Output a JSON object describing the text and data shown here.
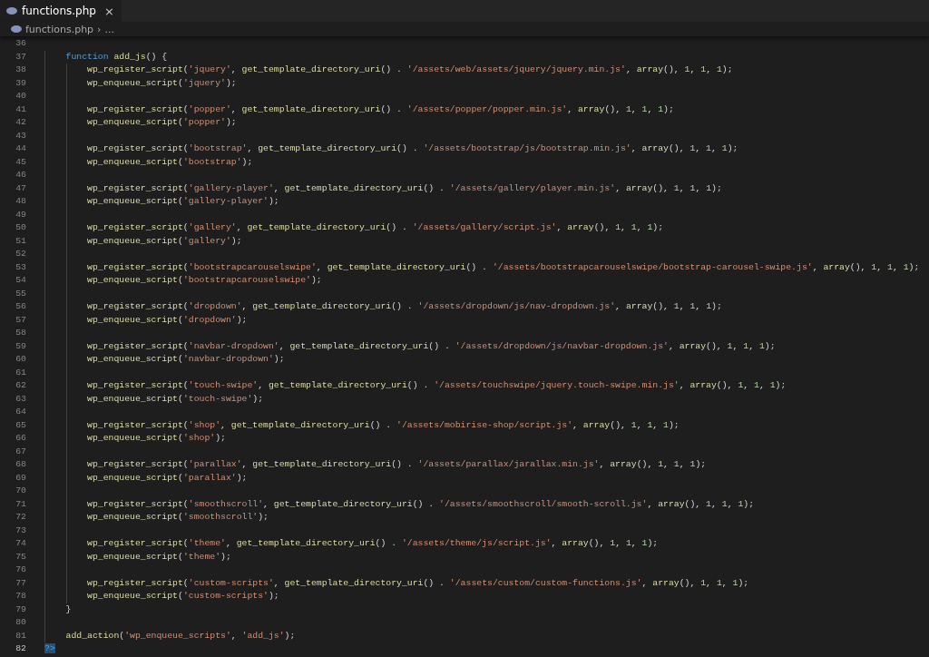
{
  "tabs": [
    {
      "label": "functions.php",
      "close": "×",
      "selected": true
    }
  ],
  "breadcrumb": {
    "file": "functions.php",
    "separator": "›",
    "more": "..."
  },
  "editor": {
    "lines": [
      {
        "number": "36",
        "current": false
      },
      {
        "number": "37",
        "current": false,
        "tokens": [
          {
            "kind": "kw",
            "text": "    function "
          },
          {
            "kind": "fn",
            "text": "add_js"
          },
          {
            "kind": "p",
            "text": "() {"
          }
        ]
      },
      {
        "number": "38",
        "current": false,
        "tokens": [
          {
            "kind": "fn",
            "text": "        wp_register_script"
          },
          {
            "kind": "p",
            "text": "("
          },
          {
            "kind": "s",
            "text": "'jquery'"
          },
          {
            "kind": "p",
            "text": ", "
          },
          {
            "kind": "fn",
            "text": "get_template_directory_uri"
          },
          {
            "kind": "p",
            "text": "() . "
          },
          {
            "kind": "s",
            "text": "'/assets/web/assets/jquery/jquery.min.js'"
          },
          {
            "kind": "p",
            "text": ", "
          },
          {
            "kind": "fn",
            "text": "array"
          },
          {
            "kind": "p",
            "text": "(), "
          },
          {
            "kind": "n",
            "text": "1"
          },
          {
            "kind": "p",
            "text": ", "
          },
          {
            "kind": "n",
            "text": "1"
          },
          {
            "kind": "p",
            "text": ", "
          },
          {
            "kind": "n",
            "text": "1"
          },
          {
            "kind": "p",
            "text": ");"
          }
        ]
      },
      {
        "number": "39",
        "current": false,
        "tokens": [
          {
            "kind": "fn",
            "text": "        wp_enqueue_script"
          },
          {
            "kind": "p",
            "text": "("
          },
          {
            "kind": "s",
            "text": "'jquery'"
          },
          {
            "kind": "p",
            "text": ");"
          }
        ]
      },
      {
        "number": "40",
        "current": false
      },
      {
        "number": "41",
        "current": false,
        "tokens": [
          {
            "kind": "fn",
            "text": "        wp_register_script"
          },
          {
            "kind": "p",
            "text": "("
          },
          {
            "kind": "s",
            "text": "'popper'"
          },
          {
            "kind": "p",
            "text": ", "
          },
          {
            "kind": "fn",
            "text": "get_template_directory_uri"
          },
          {
            "kind": "p",
            "text": "() . "
          },
          {
            "kind": "s",
            "text": "'/assets/popper/popper.min.js'"
          },
          {
            "kind": "p",
            "text": ", "
          },
          {
            "kind": "fn",
            "text": "array"
          },
          {
            "kind": "p",
            "text": "(), "
          },
          {
            "kind": "n",
            "text": "1"
          },
          {
            "kind": "p",
            "text": ", "
          },
          {
            "kind": "n",
            "text": "1"
          },
          {
            "kind": "p",
            "text": ", "
          },
          {
            "kind": "n",
            "text": "1"
          },
          {
            "kind": "p",
            "text": ");"
          }
        ]
      },
      {
        "number": "42",
        "current": false,
        "tokens": [
          {
            "kind": "fn",
            "text": "        wp_enqueue_script"
          },
          {
            "kind": "p",
            "text": "("
          },
          {
            "kind": "s",
            "text": "'popper'"
          },
          {
            "kind": "p",
            "text": ");"
          }
        ]
      },
      {
        "number": "43",
        "current": false
      },
      {
        "number": "44",
        "current": false,
        "tokens": [
          {
            "kind": "fn",
            "text": "        wp_register_script"
          },
          {
            "kind": "p",
            "text": "("
          },
          {
            "kind": "s",
            "text": "'bootstrap'"
          },
          {
            "kind": "p",
            "text": ", "
          },
          {
            "kind": "fn",
            "text": "get_template_directory_uri"
          },
          {
            "kind": "p",
            "text": "() . "
          },
          {
            "kind": "s",
            "text": "'/assets/bootstrap/js/bootstrap.min.js'"
          },
          {
            "kind": "p",
            "text": ", "
          },
          {
            "kind": "fn",
            "text": "array"
          },
          {
            "kind": "p",
            "text": "(), "
          },
          {
            "kind": "n",
            "text": "1"
          },
          {
            "kind": "p",
            "text": ", "
          },
          {
            "kind": "n",
            "text": "1"
          },
          {
            "kind": "p",
            "text": ", "
          },
          {
            "kind": "n",
            "text": "1"
          },
          {
            "kind": "p",
            "text": ");"
          }
        ]
      },
      {
        "number": "45",
        "current": false,
        "tokens": [
          {
            "kind": "fn",
            "text": "        wp_enqueue_script"
          },
          {
            "kind": "p",
            "text": "("
          },
          {
            "kind": "s",
            "text": "'bootstrap'"
          },
          {
            "kind": "p",
            "text": ");"
          }
        ]
      },
      {
        "number": "46",
        "current": false
      },
      {
        "number": "47",
        "current": false,
        "tokens": [
          {
            "kind": "fn",
            "text": "        wp_register_script"
          },
          {
            "kind": "p",
            "text": "("
          },
          {
            "kind": "s",
            "text": "'gallery-player'"
          },
          {
            "kind": "p",
            "text": ", "
          },
          {
            "kind": "fn",
            "text": "get_template_directory_uri"
          },
          {
            "kind": "p",
            "text": "() . "
          },
          {
            "kind": "s",
            "text": "'/assets/gallery/player.min.js'"
          },
          {
            "kind": "p",
            "text": ", "
          },
          {
            "kind": "fn",
            "text": "array"
          },
          {
            "kind": "p",
            "text": "(), "
          },
          {
            "kind": "n",
            "text": "1"
          },
          {
            "kind": "p",
            "text": ", "
          },
          {
            "kind": "n",
            "text": "1"
          },
          {
            "kind": "p",
            "text": ", "
          },
          {
            "kind": "n",
            "text": "1"
          },
          {
            "kind": "p",
            "text": ");"
          }
        ]
      },
      {
        "number": "48",
        "current": false,
        "tokens": [
          {
            "kind": "fn",
            "text": "        wp_enqueue_script"
          },
          {
            "kind": "p",
            "text": "("
          },
          {
            "kind": "s",
            "text": "'gallery-player'"
          },
          {
            "kind": "p",
            "text": ");"
          }
        ]
      },
      {
        "number": "49",
        "current": false
      },
      {
        "number": "50",
        "current": false,
        "tokens": [
          {
            "kind": "fn",
            "text": "        wp_register_script"
          },
          {
            "kind": "p",
            "text": "("
          },
          {
            "kind": "s",
            "text": "'gallery'"
          },
          {
            "kind": "p",
            "text": ", "
          },
          {
            "kind": "fn",
            "text": "get_template_directory_uri"
          },
          {
            "kind": "p",
            "text": "() . "
          },
          {
            "kind": "s",
            "text": "'/assets/gallery/script.js'"
          },
          {
            "kind": "p",
            "text": ", "
          },
          {
            "kind": "fn",
            "text": "array"
          },
          {
            "kind": "p",
            "text": "(), "
          },
          {
            "kind": "n",
            "text": "1"
          },
          {
            "kind": "p",
            "text": ", "
          },
          {
            "kind": "n",
            "text": "1"
          },
          {
            "kind": "p",
            "text": ", "
          },
          {
            "kind": "n",
            "text": "1"
          },
          {
            "kind": "p",
            "text": ");"
          }
        ]
      },
      {
        "number": "51",
        "current": false,
        "tokens": [
          {
            "kind": "fn",
            "text": "        wp_enqueue_script"
          },
          {
            "kind": "p",
            "text": "("
          },
          {
            "kind": "s",
            "text": "'gallery'"
          },
          {
            "kind": "p",
            "text": ");"
          }
        ]
      },
      {
        "number": "52",
        "current": false
      },
      {
        "number": "53",
        "current": false,
        "tokens": [
          {
            "kind": "fn",
            "text": "        wp_register_script"
          },
          {
            "kind": "p",
            "text": "("
          },
          {
            "kind": "s",
            "text": "'bootstrapcarouselswipe'"
          },
          {
            "kind": "p",
            "text": ", "
          },
          {
            "kind": "fn",
            "text": "get_template_directory_uri"
          },
          {
            "kind": "p",
            "text": "() . "
          },
          {
            "kind": "s",
            "text": "'/assets/bootstrapcarouselswipe/bootstrap-carousel-swipe.js'"
          },
          {
            "kind": "p",
            "text": ", "
          },
          {
            "kind": "fn",
            "text": "array"
          },
          {
            "kind": "p",
            "text": "(), "
          },
          {
            "kind": "n",
            "text": "1"
          },
          {
            "kind": "p",
            "text": ", "
          },
          {
            "kind": "n",
            "text": "1"
          },
          {
            "kind": "p",
            "text": ", "
          },
          {
            "kind": "n",
            "text": "1"
          },
          {
            "kind": "p",
            "text": ");"
          }
        ]
      },
      {
        "number": "54",
        "current": false,
        "tokens": [
          {
            "kind": "fn",
            "text": "        wp_enqueue_script"
          },
          {
            "kind": "p",
            "text": "("
          },
          {
            "kind": "s",
            "text": "'bootstrapcarouselswipe'"
          },
          {
            "kind": "p",
            "text": ");"
          }
        ]
      },
      {
        "number": "55",
        "current": false
      },
      {
        "number": "56",
        "current": false,
        "tokens": [
          {
            "kind": "fn",
            "text": "        wp_register_script"
          },
          {
            "kind": "p",
            "text": "("
          },
          {
            "kind": "s",
            "text": "'dropdown'"
          },
          {
            "kind": "p",
            "text": ", "
          },
          {
            "kind": "fn",
            "text": "get_template_directory_uri"
          },
          {
            "kind": "p",
            "text": "() . "
          },
          {
            "kind": "s",
            "text": "'/assets/dropdown/js/nav-dropdown.js'"
          },
          {
            "kind": "p",
            "text": ", "
          },
          {
            "kind": "fn",
            "text": "array"
          },
          {
            "kind": "p",
            "text": "(), "
          },
          {
            "kind": "n",
            "text": "1"
          },
          {
            "kind": "p",
            "text": ", "
          },
          {
            "kind": "n",
            "text": "1"
          },
          {
            "kind": "p",
            "text": ", "
          },
          {
            "kind": "n",
            "text": "1"
          },
          {
            "kind": "p",
            "text": ");"
          }
        ]
      },
      {
        "number": "57",
        "current": false,
        "tokens": [
          {
            "kind": "fn",
            "text": "        wp_enqueue_script"
          },
          {
            "kind": "p",
            "text": "("
          },
          {
            "kind": "s",
            "text": "'dropdown'"
          },
          {
            "kind": "p",
            "text": ");"
          }
        ]
      },
      {
        "number": "58",
        "current": false
      },
      {
        "number": "59",
        "current": false,
        "tokens": [
          {
            "kind": "fn",
            "text": "        wp_register_script"
          },
          {
            "kind": "p",
            "text": "("
          },
          {
            "kind": "s",
            "text": "'navbar-dropdown'"
          },
          {
            "kind": "p",
            "text": ", "
          },
          {
            "kind": "fn",
            "text": "get_template_directory_uri"
          },
          {
            "kind": "p",
            "text": "() . "
          },
          {
            "kind": "s",
            "text": "'/assets/dropdown/js/navbar-dropdown.js'"
          },
          {
            "kind": "p",
            "text": ", "
          },
          {
            "kind": "fn",
            "text": "array"
          },
          {
            "kind": "p",
            "text": "(), "
          },
          {
            "kind": "n",
            "text": "1"
          },
          {
            "kind": "p",
            "text": ", "
          },
          {
            "kind": "n",
            "text": "1"
          },
          {
            "kind": "p",
            "text": ", "
          },
          {
            "kind": "n",
            "text": "1"
          },
          {
            "kind": "p",
            "text": ");"
          }
        ]
      },
      {
        "number": "60",
        "current": false,
        "tokens": [
          {
            "kind": "fn",
            "text": "        wp_enqueue_script"
          },
          {
            "kind": "p",
            "text": "("
          },
          {
            "kind": "s",
            "text": "'navbar-dropdown'"
          },
          {
            "kind": "p",
            "text": ");"
          }
        ]
      },
      {
        "number": "61",
        "current": false
      },
      {
        "number": "62",
        "current": false,
        "tokens": [
          {
            "kind": "fn",
            "text": "        wp_register_script"
          },
          {
            "kind": "p",
            "text": "("
          },
          {
            "kind": "s",
            "text": "'touch-swipe'"
          },
          {
            "kind": "p",
            "text": ", "
          },
          {
            "kind": "fn",
            "text": "get_template_directory_uri"
          },
          {
            "kind": "p",
            "text": "() . "
          },
          {
            "kind": "s",
            "text": "'/assets/touchswipe/jquery.touch-swipe.min.js'"
          },
          {
            "kind": "p",
            "text": ", "
          },
          {
            "kind": "fn",
            "text": "array"
          },
          {
            "kind": "p",
            "text": "(), "
          },
          {
            "kind": "n",
            "text": "1"
          },
          {
            "kind": "p",
            "text": ", "
          },
          {
            "kind": "n",
            "text": "1"
          },
          {
            "kind": "p",
            "text": ", "
          },
          {
            "kind": "n",
            "text": "1"
          },
          {
            "kind": "p",
            "text": ");"
          }
        ]
      },
      {
        "number": "63",
        "current": false,
        "tokens": [
          {
            "kind": "fn",
            "text": "        wp_enqueue_script"
          },
          {
            "kind": "p",
            "text": "("
          },
          {
            "kind": "s",
            "text": "'touch-swipe'"
          },
          {
            "kind": "p",
            "text": ");"
          }
        ]
      },
      {
        "number": "64",
        "current": false
      },
      {
        "number": "65",
        "current": false,
        "tokens": [
          {
            "kind": "fn",
            "text": "        wp_register_script"
          },
          {
            "kind": "p",
            "text": "("
          },
          {
            "kind": "s",
            "text": "'shop'"
          },
          {
            "kind": "p",
            "text": ", "
          },
          {
            "kind": "fn",
            "text": "get_template_directory_uri"
          },
          {
            "kind": "p",
            "text": "() . "
          },
          {
            "kind": "s",
            "text": "'/assets/mobirise-shop/script.js'"
          },
          {
            "kind": "p",
            "text": ", "
          },
          {
            "kind": "fn",
            "text": "array"
          },
          {
            "kind": "p",
            "text": "(), "
          },
          {
            "kind": "n",
            "text": "1"
          },
          {
            "kind": "p",
            "text": ", "
          },
          {
            "kind": "n",
            "text": "1"
          },
          {
            "kind": "p",
            "text": ", "
          },
          {
            "kind": "n",
            "text": "1"
          },
          {
            "kind": "p",
            "text": ");"
          }
        ]
      },
      {
        "number": "66",
        "current": false,
        "tokens": [
          {
            "kind": "fn",
            "text": "        wp_enqueue_script"
          },
          {
            "kind": "p",
            "text": "("
          },
          {
            "kind": "s",
            "text": "'shop'"
          },
          {
            "kind": "p",
            "text": ");"
          }
        ]
      },
      {
        "number": "67",
        "current": false
      },
      {
        "number": "68",
        "current": false,
        "tokens": [
          {
            "kind": "fn",
            "text": "        wp_register_script"
          },
          {
            "kind": "p",
            "text": "("
          },
          {
            "kind": "s",
            "text": "'parallax'"
          },
          {
            "kind": "p",
            "text": ", "
          },
          {
            "kind": "fn",
            "text": "get_template_directory_uri"
          },
          {
            "kind": "p",
            "text": "() . "
          },
          {
            "kind": "s",
            "text": "'/assets/parallax/jarallax.min.js'"
          },
          {
            "kind": "p",
            "text": ", "
          },
          {
            "kind": "fn",
            "text": "array"
          },
          {
            "kind": "p",
            "text": "(), "
          },
          {
            "kind": "n",
            "text": "1"
          },
          {
            "kind": "p",
            "text": ", "
          },
          {
            "kind": "n",
            "text": "1"
          },
          {
            "kind": "p",
            "text": ", "
          },
          {
            "kind": "n",
            "text": "1"
          },
          {
            "kind": "p",
            "text": ");"
          }
        ]
      },
      {
        "number": "69",
        "current": false,
        "tokens": [
          {
            "kind": "fn",
            "text": "        wp_enqueue_script"
          },
          {
            "kind": "p",
            "text": "("
          },
          {
            "kind": "s",
            "text": "'parallax'"
          },
          {
            "kind": "p",
            "text": ");"
          }
        ]
      },
      {
        "number": "70",
        "current": false
      },
      {
        "number": "71",
        "current": false,
        "tokens": [
          {
            "kind": "fn",
            "text": "        wp_register_script"
          },
          {
            "kind": "p",
            "text": "("
          },
          {
            "kind": "s",
            "text": "'smoothscroll'"
          },
          {
            "kind": "p",
            "text": ", "
          },
          {
            "kind": "fn",
            "text": "get_template_directory_uri"
          },
          {
            "kind": "p",
            "text": "() . "
          },
          {
            "kind": "s",
            "text": "'/assets/smoothscroll/smooth-scroll.js'"
          },
          {
            "kind": "p",
            "text": ", "
          },
          {
            "kind": "fn",
            "text": "array"
          },
          {
            "kind": "p",
            "text": "(), "
          },
          {
            "kind": "n",
            "text": "1"
          },
          {
            "kind": "p",
            "text": ", "
          },
          {
            "kind": "n",
            "text": "1"
          },
          {
            "kind": "p",
            "text": ", "
          },
          {
            "kind": "n",
            "text": "1"
          },
          {
            "kind": "p",
            "text": ");"
          }
        ]
      },
      {
        "number": "72",
        "current": false,
        "tokens": [
          {
            "kind": "fn",
            "text": "        wp_enqueue_script"
          },
          {
            "kind": "p",
            "text": "("
          },
          {
            "kind": "s",
            "text": "'smoothscroll'"
          },
          {
            "kind": "p",
            "text": ");"
          }
        ]
      },
      {
        "number": "73",
        "current": false
      },
      {
        "number": "74",
        "current": false,
        "tokens": [
          {
            "kind": "fn",
            "text": "        wp_register_script"
          },
          {
            "kind": "p",
            "text": "("
          },
          {
            "kind": "s",
            "text": "'theme'"
          },
          {
            "kind": "p",
            "text": ", "
          },
          {
            "kind": "fn",
            "text": "get_template_directory_uri"
          },
          {
            "kind": "p",
            "text": "() . "
          },
          {
            "kind": "s",
            "text": "'/assets/theme/js/script.js'"
          },
          {
            "kind": "p",
            "text": ", "
          },
          {
            "kind": "fn",
            "text": "array"
          },
          {
            "kind": "p",
            "text": "(), "
          },
          {
            "kind": "n",
            "text": "1"
          },
          {
            "kind": "p",
            "text": ", "
          },
          {
            "kind": "n",
            "text": "1"
          },
          {
            "kind": "p",
            "text": ", "
          },
          {
            "kind": "n",
            "text": "1"
          },
          {
            "kind": "p",
            "text": ");"
          }
        ]
      },
      {
        "number": "75",
        "current": false,
        "tokens": [
          {
            "kind": "fn",
            "text": "        wp_enqueue_script"
          },
          {
            "kind": "p",
            "text": "("
          },
          {
            "kind": "s",
            "text": "'theme'"
          },
          {
            "kind": "p",
            "text": ");"
          }
        ]
      },
      {
        "number": "76",
        "current": false
      },
      {
        "number": "77",
        "current": false,
        "tokens": [
          {
            "kind": "fn",
            "text": "        wp_register_script"
          },
          {
            "kind": "p",
            "text": "("
          },
          {
            "kind": "s",
            "text": "'custom-scripts'"
          },
          {
            "kind": "p",
            "text": ", "
          },
          {
            "kind": "fn",
            "text": "get_template_directory_uri"
          },
          {
            "kind": "p",
            "text": "() . "
          },
          {
            "kind": "s",
            "text": "'/assets/custom/custom-functions.js'"
          },
          {
            "kind": "p",
            "text": ", "
          },
          {
            "kind": "fn",
            "text": "array"
          },
          {
            "kind": "p",
            "text": "(), "
          },
          {
            "kind": "n",
            "text": "1"
          },
          {
            "kind": "p",
            "text": ", "
          },
          {
            "kind": "n",
            "text": "1"
          },
          {
            "kind": "p",
            "text": ", "
          },
          {
            "kind": "n",
            "text": "1"
          },
          {
            "kind": "p",
            "text": ");"
          }
        ]
      },
      {
        "number": "78",
        "current": false,
        "tokens": [
          {
            "kind": "fn",
            "text": "        wp_enqueue_script"
          },
          {
            "kind": "p",
            "text": "("
          },
          {
            "kind": "s",
            "text": "'custom-scripts'"
          },
          {
            "kind": "p",
            "text": ");"
          }
        ]
      },
      {
        "number": "79",
        "current": false,
        "tokens": [
          {
            "kind": "p",
            "text": "    }"
          }
        ]
      },
      {
        "number": "80",
        "current": false
      },
      {
        "number": "81",
        "current": false,
        "tokens": [
          {
            "kind": "fn",
            "text": "    add_action"
          },
          {
            "kind": "p",
            "text": "("
          },
          {
            "kind": "s",
            "text": "'wp_enqueue_scripts'"
          },
          {
            "kind": "p",
            "text": ", "
          },
          {
            "kind": "s",
            "text": "'add_js'"
          },
          {
            "kind": "p",
            "text": ");"
          }
        ]
      },
      {
        "number": "82",
        "current": true,
        "tokens": [
          {
            "kind": "tag",
            "text": "?>"
          }
        ]
      }
    ]
  }
}
